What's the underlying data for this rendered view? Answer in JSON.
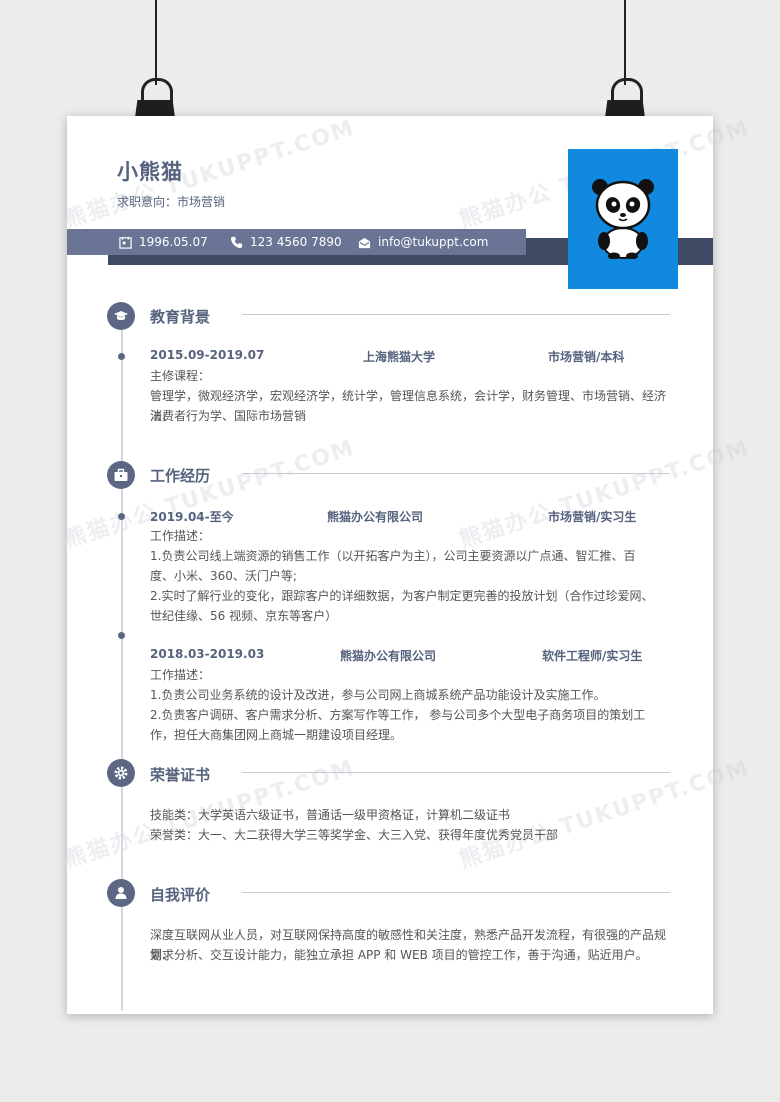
{
  "resume": {
    "name": "小熊猫",
    "intent": "求职意向：市场营销",
    "birth": "1996.05.07",
    "phone": "123 4560 7890",
    "email": "info@tukuppt.com"
  },
  "sections": {
    "education": {
      "title": "教育背景",
      "period": "2015.09-2019.07",
      "school": "上海熊猫大学",
      "major": "市场营销/本科",
      "label": "主修课程：",
      "line1": "管理学，微观经济学，宏观经济学，统计学，管理信息系统，会计学，财务管理、市场营销、经济法、",
      "line2": "消费者行为学、国际市场营销"
    },
    "work": {
      "title": "工作经历",
      "jobs": [
        {
          "period": "2019.04-至今",
          "company": "熊猫办公有限公司",
          "role": "市场营销/实习生",
          "label": "工作描述：",
          "l1": "1.负责公司线上端资源的销售工作（以开拓客户为主），公司主要资源以广点通、智汇推、百",
          "l2": "度、小米、360、沃门户等;",
          "l3": "2.实时了解行业的变化，跟踪客户的详细数据，为客户制定更完善的投放计划（合作过珍爱网、",
          "l4": "世纪佳缘、56 视频、京东等客户）"
        },
        {
          "period": "2018.03-2019.03",
          "company": "熊猫办公有限公司",
          "role": "软件工程师/实习生",
          "label": "工作描述：",
          "l1": "1.负责公司业务系统的设计及改进，参与公司网上商城系统产品功能设计及实施工作。",
          "l2": "2.负责客户调研、客户需求分析、方案写作等工作，  参与公司多个大型电子商务项目的策划工",
          "l3": "作，担任大商集团网上商城一期建设项目经理。"
        }
      ]
    },
    "honors": {
      "title": "荣誉证书",
      "l1": "技能类：大学英语六级证书，普通话一级甲资格证，计算机二级证书",
      "l2": "荣誉类：大一、大二获得大学三等奖学金、大三入党、获得年度优秀党员干部"
    },
    "self": {
      "title": "自我评价",
      "l1": "深度互联网从业人员，对互联网保持高度的敏感性和关注度，熟悉产品开发流程，有很强的产品规划、",
      "l2": "需求分析、交互设计能力，能独立承担 APP 和 WEB 项目的管控工作，善于沟通，贴近用户。"
    }
  },
  "watermark": "熊猫办公 TUKUPPT.COM",
  "colors": {
    "accent": "#56637e",
    "photo_bg": "#1189df",
    "bar": "#6a7595",
    "dark_bar": "#3e4963"
  }
}
